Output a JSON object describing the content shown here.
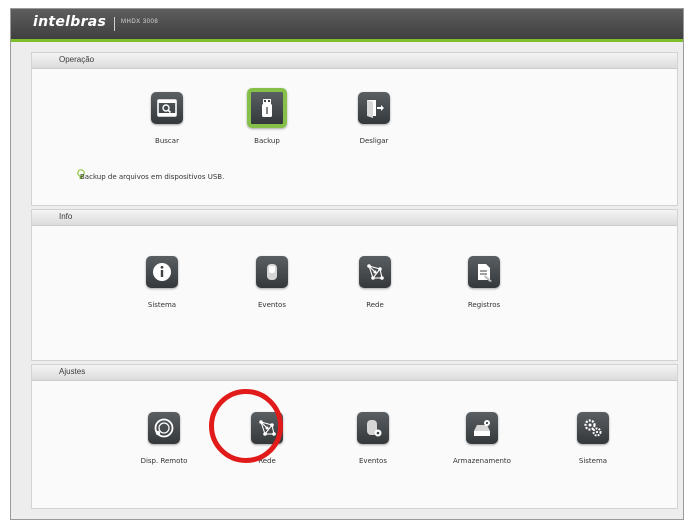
{
  "header": {
    "logo": "intelbras",
    "model": "MHDX 3008"
  },
  "sections": {
    "operacao": {
      "title": "Operação",
      "tip": "Backup de arquivos em dispositivos USB.",
      "items": [
        {
          "label": "Buscar",
          "icon": "search-film-icon"
        },
        {
          "label": "Backup",
          "icon": "usb-icon",
          "selected": true
        },
        {
          "label": "Desligar",
          "icon": "exit-door-icon"
        }
      ]
    },
    "info": {
      "title": "Info",
      "items": [
        {
          "label": "Sistema",
          "icon": "info-icon"
        },
        {
          "label": "Eventos",
          "icon": "event-icon"
        },
        {
          "label": "Rede",
          "icon": "network-icon"
        },
        {
          "label": "Registros",
          "icon": "log-icon"
        }
      ]
    },
    "ajustes": {
      "title": "Ajustes",
      "items": [
        {
          "label": "Disp. Remoto",
          "icon": "remote-device-icon"
        },
        {
          "label": "Rede",
          "icon": "network-icon",
          "highlighted": true
        },
        {
          "label": "Eventos",
          "icon": "event-settings-icon"
        },
        {
          "label": "Armazenamento",
          "icon": "storage-icon"
        },
        {
          "label": "Sistema",
          "icon": "gears-icon"
        }
      ]
    }
  },
  "colors": {
    "accent": "#86c04a",
    "highlight": "#e11a1a",
    "tile": "#3f4346"
  }
}
